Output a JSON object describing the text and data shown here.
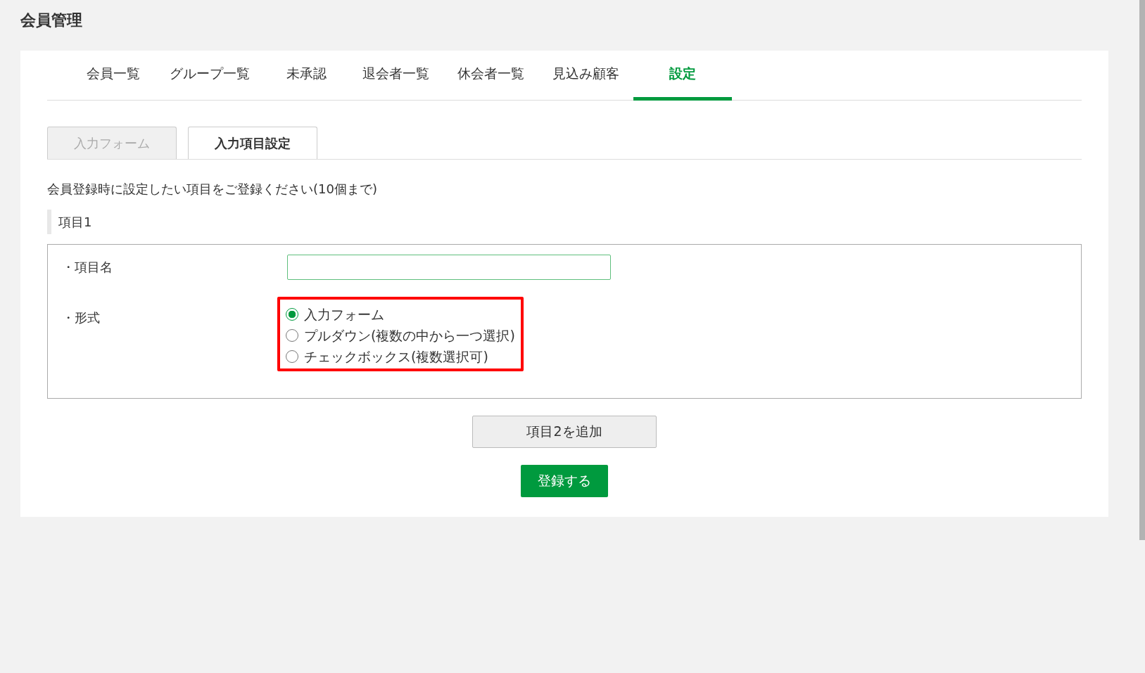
{
  "page_title": "会員管理",
  "tabs": [
    {
      "label": "会員一覧",
      "selected": false
    },
    {
      "label": "グループ一覧",
      "selected": false
    },
    {
      "label": "未承認",
      "selected": false
    },
    {
      "label": "退会者一覧",
      "selected": false
    },
    {
      "label": "休会者一覧",
      "selected": false
    },
    {
      "label": "見込み顧客",
      "selected": false
    },
    {
      "label": "設定",
      "selected": true
    }
  ],
  "subtabs": [
    {
      "label": "入力フォーム",
      "selected": false
    },
    {
      "label": "入力項目設定",
      "selected": true
    }
  ],
  "instruction": "会員登録時に設定したい項目をご登録ください(10個まで)",
  "item_heading": "項目1",
  "fields": {
    "name_label": "・項目名",
    "format_label": "・形式",
    "format_options": [
      {
        "label": "入力フォーム",
        "selected": true
      },
      {
        "label": "プルダウン(複数の中から一つ選択)",
        "selected": false
      },
      {
        "label": "チェックボックス(複数選択可)",
        "selected": false
      }
    ],
    "format_highlighted": true
  },
  "add_button": "項目2を追加",
  "submit_button": "登録する"
}
